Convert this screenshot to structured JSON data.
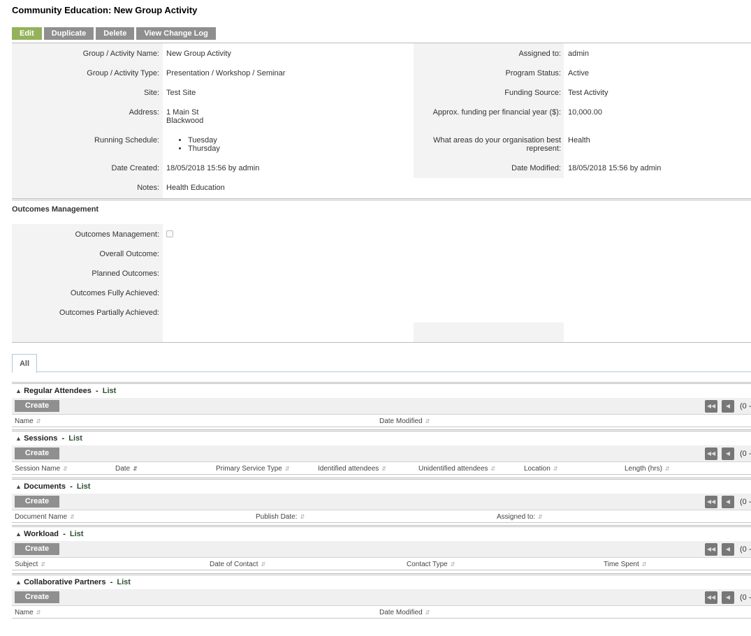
{
  "page": {
    "title": "Community Education: New Group Activity"
  },
  "actions": {
    "edit": "Edit",
    "duplicate": "Duplicate",
    "delete": "Delete",
    "change_log": "View Change Log"
  },
  "details": {
    "name_label": "Group / Activity Name:",
    "name": "New Group Activity",
    "type_label": "Group / Activity Type:",
    "type": "Presentation / Workshop / Seminar",
    "site_label": "Site:",
    "site": "Test Site",
    "address_label": "Address:",
    "address_line1": "1 Main St",
    "address_line2": "Blackwood",
    "schedule_label": "Running Schedule:",
    "schedule": [
      "Tuesday",
      "Thursday"
    ],
    "created_label": "Date Created:",
    "created": "18/05/2018 15:56 by admin",
    "notes_label": "Notes:",
    "notes": "Health Education",
    "assigned_label": "Assigned to:",
    "assigned": "admin",
    "status_label": "Program Status:",
    "status": "Active",
    "funding_label": "Funding Source:",
    "funding": "Test Activity",
    "approx_label": "Approx. funding per financial year ($):",
    "approx": "10,000.00",
    "areas_label_1": "What areas do your organisation best",
    "areas_label_2": "represent:",
    "areas": "Health",
    "modified_label": "Date Modified:",
    "modified": "18/05/2018 15:56 by admin"
  },
  "outcomes": {
    "section_title": "Outcomes Management",
    "mgmt_label": "Outcomes Management:",
    "overall_label": "Overall Outcome:",
    "planned_label": "Planned Outcomes:",
    "full_label": "Outcomes Fully Achieved:",
    "partial_label": "Outcomes Partially Achieved:",
    "mgmt_checked": false
  },
  "tabs": {
    "all": "All"
  },
  "common": {
    "dash": "-",
    "list": "List",
    "create": "Create",
    "range": "(0 -",
    "collapse_icon": "double-chevron-up-icon",
    "first_icon": "first-page-icon",
    "prev_icon": "prev-page-icon",
    "sort_icon": "sort-icon"
  },
  "subpanels": {
    "attendees": {
      "title": "Regular Attendees",
      "cols": [
        "Name",
        "Date Modified"
      ]
    },
    "sessions": {
      "title": "Sessions",
      "cols": [
        "Session Name",
        "Date",
        "Primary Service Type",
        "Identified attendees",
        "Unidentified attendees",
        "Location",
        "Length (hrs)"
      ]
    },
    "documents": {
      "title": "Documents",
      "cols": [
        "Document Name",
        "Publish Date:",
        "Assigned to:"
      ]
    },
    "workload": {
      "title": "Workload",
      "cols": [
        "Subject",
        "Date of Contact",
        "Contact Type",
        "Time Spent"
      ]
    },
    "partners": {
      "title": "Collaborative Partners",
      "cols": [
        "Name",
        "Date Modified"
      ]
    }
  }
}
